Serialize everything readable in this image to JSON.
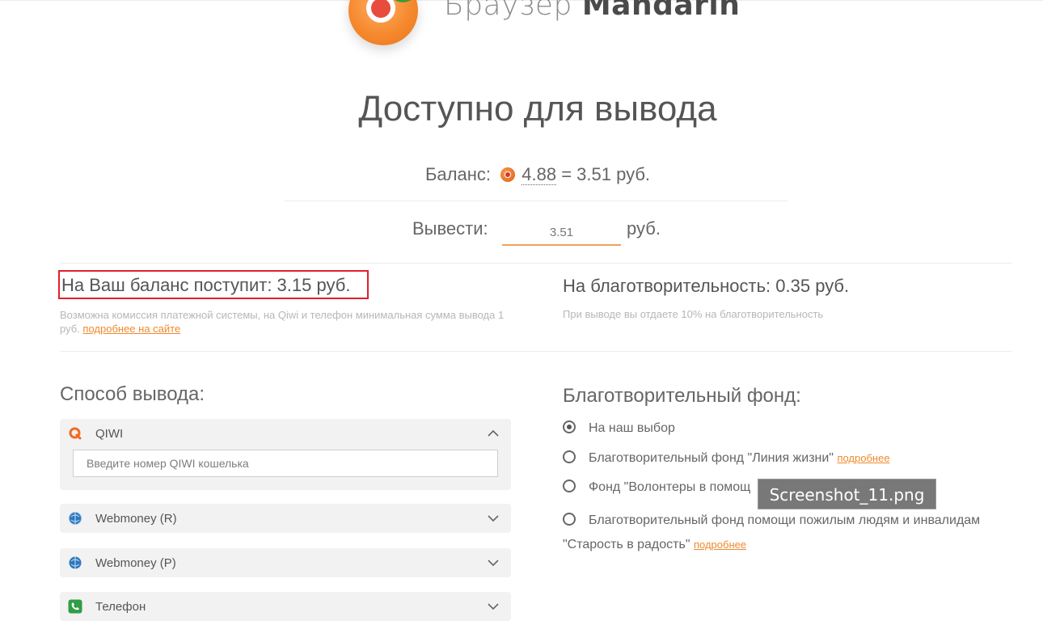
{
  "header": {
    "brand_light": "Браузер",
    "brand_bold": "Mandarin"
  },
  "page_title": "Доступно для вывода",
  "balance": {
    "label": "Баланс:",
    "coins": "4.88",
    "equals": "= 3.51 руб."
  },
  "withdraw": {
    "label": "Вывести:",
    "value": "3.51",
    "unit": "руб."
  },
  "receive": {
    "text": "На Ваш баланс поступит: 3.15 руб.",
    "note": "Возможна комиссия платежной системы, на Qiwi и телефон минимальная сумма вывода 1 руб.",
    "note_link": "подробнее на сайте"
  },
  "charity_summary": {
    "text": "На благотворительность: 0.35 руб.",
    "note": "При выводе вы отдаете 10% на благотворительность"
  },
  "methods": {
    "title": "Способ вывода:",
    "items": [
      {
        "label": "QIWI",
        "expanded": true,
        "placeholder": "Введите номер QIWI кошелька",
        "icon": "qiwi-icon"
      },
      {
        "label": "Webmoney (R)",
        "expanded": false,
        "icon": "webmoney-icon"
      },
      {
        "label": "Webmoney (P)",
        "expanded": false,
        "icon": "webmoney-icon"
      },
      {
        "label": "Телефон",
        "expanded": false,
        "icon": "phone-icon"
      }
    ]
  },
  "charity": {
    "title": "Благотворительный фонд:",
    "options": [
      {
        "label": "На наш выбор",
        "checked": true
      },
      {
        "label": "Благотворительный фонд \"Линия жизни\"",
        "link": "подробнее"
      },
      {
        "label": "Фонд \"Волонтеры в помощ"
      },
      {
        "label": "Благотворительный фонд помощи пожилым людям и инвалидам",
        "label_line2": "\"Старость в радость\"",
        "link": "подробнее"
      }
    ]
  },
  "tooltip": "Screenshot_11.png",
  "colors": {
    "accent": "#ee8a2c",
    "highlight_border": "#e0202a",
    "panel_bg": "#f2f2f2"
  }
}
